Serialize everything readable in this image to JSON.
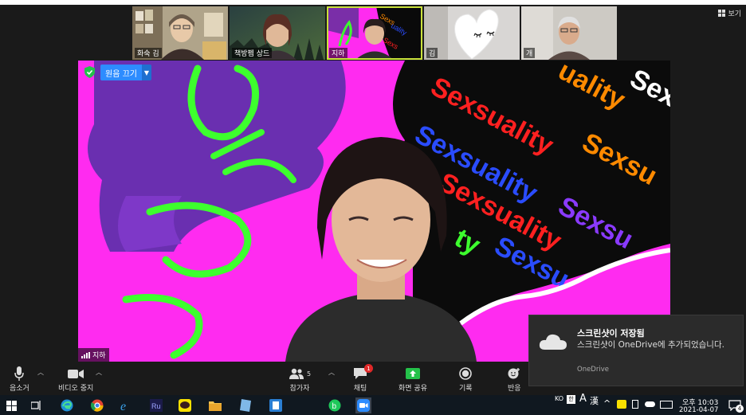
{
  "gallery": {
    "participants": [
      {
        "name": "화숙 김",
        "bg": "#8a7a60"
      },
      {
        "name": "책방펨 상드",
        "bg": "#3c4a42"
      },
      {
        "name": "지하",
        "bg": "#ff2bf0",
        "active": true
      },
      {
        "name": "김",
        "bg": "#d8d8d8"
      },
      {
        "name": "개",
        "bg": "#c9c6bf"
      }
    ],
    "view_label": "보기"
  },
  "main_video": {
    "original_sound_label": "원음 끄기",
    "speaker_name": "지하",
    "background_words": "Sexsuality",
    "handwriting": "queer"
  },
  "toolbar": {
    "mute_label": "음소거",
    "video_label": "비디오 중지",
    "participants_label": "참가자",
    "participants_count": "5",
    "chat_label": "채팅",
    "chat_badge": "1",
    "share_label": "화면 공유",
    "record_label": "기록",
    "reactions_label": "반응"
  },
  "toast": {
    "title": "스크린샷이 저장됨",
    "body": "스크린샷이 OneDrive에 추가되었습니다.",
    "app": "OneDrive"
  },
  "taskbar": {
    "lang": "KO",
    "ime_a": "A",
    "ime_hanja": "漢",
    "time": "오후 10:03",
    "date": "2021-04-07",
    "notification_count": "4"
  },
  "colors": {
    "accent_blue": "#2d8cff",
    "share_green": "#24c24a",
    "active_outline": "#c9e13a",
    "magenta": "#ff2bf0"
  }
}
